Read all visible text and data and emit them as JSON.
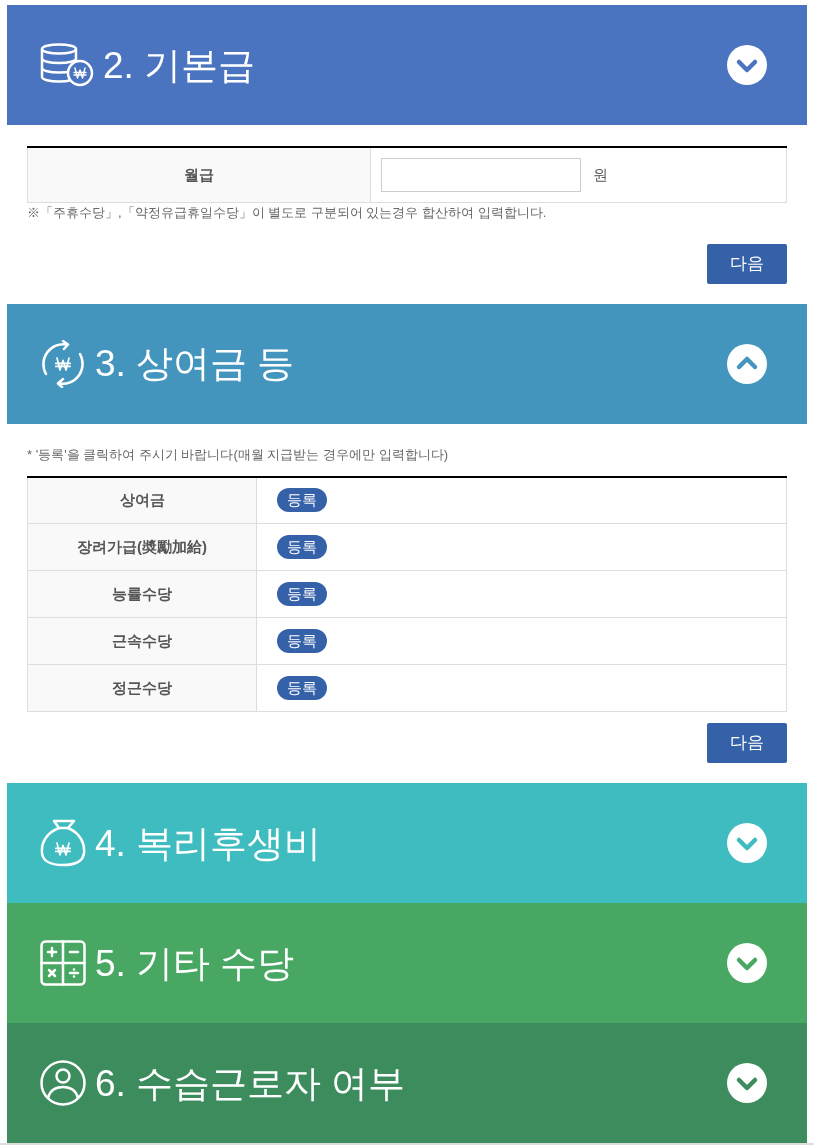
{
  "sections": [
    {
      "title": "2. 기본급",
      "color": "#4a74c0",
      "expanded": false,
      "body": [
        {
          "kind": "table",
          "rows": [
            {
              "kind": "input",
              "label": "월급",
              "unit": "원"
            }
          ]
        },
        {
          "kind": "note",
          "text": "※「주휴수당」,「약정유급휴일수당」이 별도로 구분되어 있는경우 합산하여 입력합니다."
        },
        {
          "kind": "button",
          "label": "다음"
        }
      ]
    },
    {
      "title": "3. 상여금 등",
      "color": "#4495bd",
      "expanded": true,
      "body": [
        {
          "kind": "note",
          "text": "* '등록'을 클릭하여 주시기 바랍니다(매월 지급받는 경우에만 입력합니다)"
        },
        {
          "kind": "table",
          "rows": [
            {
              "kind": "action",
              "label": "상여금",
              "action": "등록"
            },
            {
              "kind": "action",
              "label": "장려가급(奬勵加給)",
              "action": "등록"
            },
            {
              "kind": "action",
              "label": "능률수당",
              "action": "등록"
            },
            {
              "kind": "action",
              "label": "근속수당",
              "action": "등록"
            },
            {
              "kind": "action",
              "label": "정근수당",
              "action": "등록"
            }
          ]
        },
        {
          "kind": "button",
          "label": "다음"
        }
      ]
    },
    {
      "title": "4. 복리후생비",
      "color": "#3ebcbf",
      "expanded": false
    },
    {
      "title": "5. 기타 수당",
      "color": "#49a764",
      "expanded": false
    },
    {
      "title": "6. 수습근로자 여부",
      "color": "#3c8c5e",
      "expanded": false
    }
  ]
}
